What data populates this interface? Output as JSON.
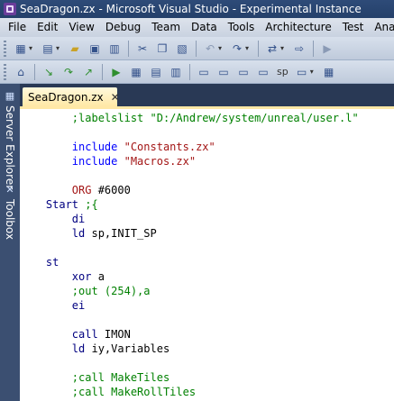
{
  "window": {
    "title": "SeaDragon.zx - Microsoft Visual Studio - Experimental Instance"
  },
  "menu": [
    "File",
    "Edit",
    "View",
    "Debug",
    "Team",
    "Data",
    "Tools",
    "Architecture",
    "Test",
    "Analyz"
  ],
  "toolbar1": {
    "icons": [
      "project-icon",
      "add-item-icon",
      "open-icon",
      "save-icon",
      "save-all-icon",
      "cut-icon",
      "copy-icon",
      "paste-icon",
      "undo-icon",
      "redo-icon",
      "navigate-icon",
      "start-icon"
    ]
  },
  "toolbar2": {
    "icons": [
      "misc-icon",
      "step1-icon",
      "step2-icon",
      "step3-icon",
      "run-icon",
      "tile1-icon",
      "tile2-icon",
      "tile3-icon",
      "window1-icon",
      "window2-icon",
      "window3-icon",
      "sp-icon"
    ],
    "sp_label": "sp"
  },
  "sidebar": {
    "tabs": [
      {
        "label": "Server Explorer",
        "icon": "server-explorer-icon"
      },
      {
        "label": "Toolbox",
        "icon": "toolbox-icon"
      }
    ]
  },
  "tab": {
    "label": "SeaDragon.zx",
    "close": "✕"
  },
  "code": {
    "lines": [
      {
        "type": "comment",
        "indent": "        ",
        "text": ";labelslist \"D:/Andrew/system/unreal/user.l\""
      },
      {
        "type": "blank"
      },
      {
        "type": "include",
        "indent": "        ",
        "kw": "include",
        "rest": " \"Constants.zx\""
      },
      {
        "type": "include",
        "indent": "        ",
        "kw": "include",
        "rest": " \"Macros.zx\""
      },
      {
        "type": "blank"
      },
      {
        "type": "org",
        "indent": "        ",
        "kw": "ORG",
        "rest": " #6000"
      },
      {
        "type": "label",
        "indent": "    ",
        "label": "Start",
        "rest": " ;{"
      },
      {
        "type": "instr",
        "indent": "        ",
        "kw": "di",
        "rest": ""
      },
      {
        "type": "instr",
        "indent": "        ",
        "kw": "ld",
        "rest": " sp,INIT_SP"
      },
      {
        "type": "blank"
      },
      {
        "type": "label",
        "indent": "    ",
        "label": "st",
        "rest": ""
      },
      {
        "type": "instr",
        "indent": "        ",
        "kw": "xor",
        "rest": " a"
      },
      {
        "type": "comment",
        "indent": "        ",
        "text": ";out (254),a"
      },
      {
        "type": "instr",
        "indent": "        ",
        "kw": "ei",
        "rest": ""
      },
      {
        "type": "blank"
      },
      {
        "type": "instr",
        "indent": "        ",
        "kw": "call",
        "rest": " IMON"
      },
      {
        "type": "instr",
        "indent": "        ",
        "kw": "ld",
        "rest": " iy,Variables"
      },
      {
        "type": "blank"
      },
      {
        "type": "comment",
        "indent": "        ",
        "text": ";call MakeTiles"
      },
      {
        "type": "comment",
        "indent": "        ",
        "text": ";call MakeRollTiles"
      }
    ]
  }
}
